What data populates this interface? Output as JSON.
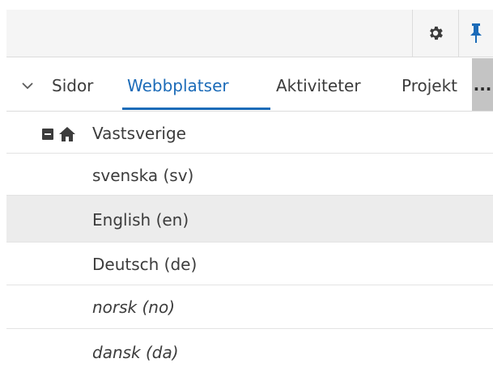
{
  "toolbar": {
    "icons": [
      "gear-icon",
      "pin-icon"
    ],
    "pin_color": "#1b6bb8"
  },
  "tabs": {
    "items": [
      {
        "label": "Sidor",
        "active": false
      },
      {
        "label": "Webbplatser",
        "active": true
      },
      {
        "label": "Aktiviteter",
        "active": false
      },
      {
        "label": "Projekt",
        "active": false
      }
    ],
    "more_label": "..."
  },
  "tree": {
    "root": {
      "label": "Vastsverige",
      "expanded": true
    },
    "languages": [
      {
        "label": "svenska (sv)",
        "italic": false,
        "selected": false
      },
      {
        "label": "English (en)",
        "italic": false,
        "selected": true
      },
      {
        "label": "Deutsch (de)",
        "italic": false,
        "selected": false
      },
      {
        "label": "norsk (no)",
        "italic": true,
        "selected": false
      },
      {
        "label": "dansk (da)",
        "italic": true,
        "selected": false
      }
    ]
  },
  "colors": {
    "accent": "#1b6bb8",
    "selected_row": "#ececec",
    "toolbar_bg": "#f5f5f5"
  }
}
